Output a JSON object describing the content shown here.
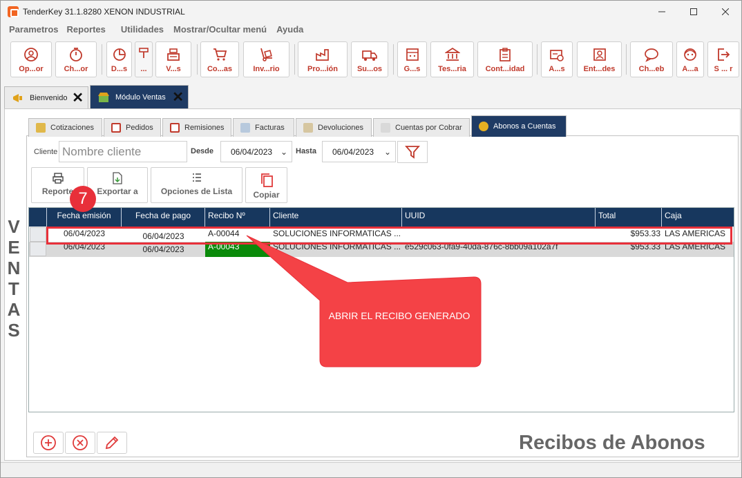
{
  "window": {
    "title": "TenderKey 31.1.8280 XENON INDUSTRIAL"
  },
  "menu": [
    "Parametros",
    "Reportes",
    "Utilidades",
    "Mostrar/Ocultar menú",
    "Ayuda"
  ],
  "toolbar": [
    {
      "label": "Op...or",
      "icon": "user-circle-icon"
    },
    {
      "label": "Ch...or",
      "icon": "stopwatch-icon"
    },
    {
      "label": "D...s",
      "icon": "pie-chart-icon"
    },
    {
      "label": "...",
      "icon": "tools-icon"
    },
    {
      "label": "V...s",
      "icon": "cash-register-icon"
    },
    {
      "label": "Co...as",
      "icon": "cart-icon"
    },
    {
      "label": "Inv...rio",
      "icon": "hand-truck-icon"
    },
    {
      "label": "Pro...ión",
      "icon": "factory-icon"
    },
    {
      "label": "Su...os",
      "icon": "truck-icon"
    },
    {
      "label": "G...s",
      "icon": "calculator-icon"
    },
    {
      "label": "Tes...ria",
      "icon": "bank-icon"
    },
    {
      "label": "Cont...idad",
      "icon": "clipboard-icon"
    },
    {
      "label": "A...s",
      "icon": "settings-card-icon"
    },
    {
      "label": "Ent...des",
      "icon": "contact-card-icon"
    },
    {
      "label": "Ch...eb",
      "icon": "chat-icon"
    },
    {
      "label": "A...a",
      "icon": "support-agent-icon"
    },
    {
      "label": "S ... r",
      "icon": "exit-icon"
    }
  ],
  "doc_tabs": [
    {
      "label": "Bienvenido",
      "icon": "megaphone-icon"
    },
    {
      "label": "Módulo Ventas",
      "icon": "store-icon"
    }
  ],
  "side_label": "VENTAS",
  "sub_tabs": [
    "Cotizaciones",
    "Pedidos",
    "Remisiones",
    "Facturas",
    "Devoluciones",
    "Cuentas por Cobrar",
    "Abonos a Cuentas"
  ],
  "filter": {
    "cliente_label": "Cliente",
    "cliente_placeholder": "Nombre cliente",
    "desde_label": "Desde",
    "desde_value": "06/04/2023",
    "hasta_label": "Hasta",
    "hasta_value": "06/04/2023"
  },
  "actions": {
    "reporte": "Reporte",
    "exportar": "Exportar a",
    "opciones": "Opciones de Lista",
    "copiar": "Copiar"
  },
  "grid": {
    "columns": [
      "Fecha emisión",
      "Fecha de pago",
      "Recibo Nº",
      "Cliente",
      "UUID",
      "Total",
      "Caja"
    ],
    "rows": [
      {
        "fecha_emision": "06/04/2023",
        "fecha_pago": "06/04/2023",
        "recibo": "A-00044",
        "cliente": "SOLUCIONES INFORMATICAS ...",
        "uuid": "",
        "total": "$953.33",
        "caja": "LAS AMERICAS"
      },
      {
        "fecha_emision": "06/04/2023",
        "fecha_pago": "06/04/2023",
        "recibo": "A-00043",
        "cliente": "SOLUCIONES INFORMATICAS ...",
        "uuid": "e529c063-0fa9-40da-876c-8bb09a102a7f",
        "total": "$953.33",
        "caja": "LAS AMERICAS"
      }
    ]
  },
  "annotation": {
    "step": "7",
    "callout": "ABRIR EL RECIBO GENERADO"
  },
  "bottom_title": "Recibos de Abonos",
  "colors": {
    "accent": "#1f3b64",
    "annotation": "#e8303a",
    "toolbar_text": "#c0392b",
    "recibo_green": "#0a8a0a"
  }
}
